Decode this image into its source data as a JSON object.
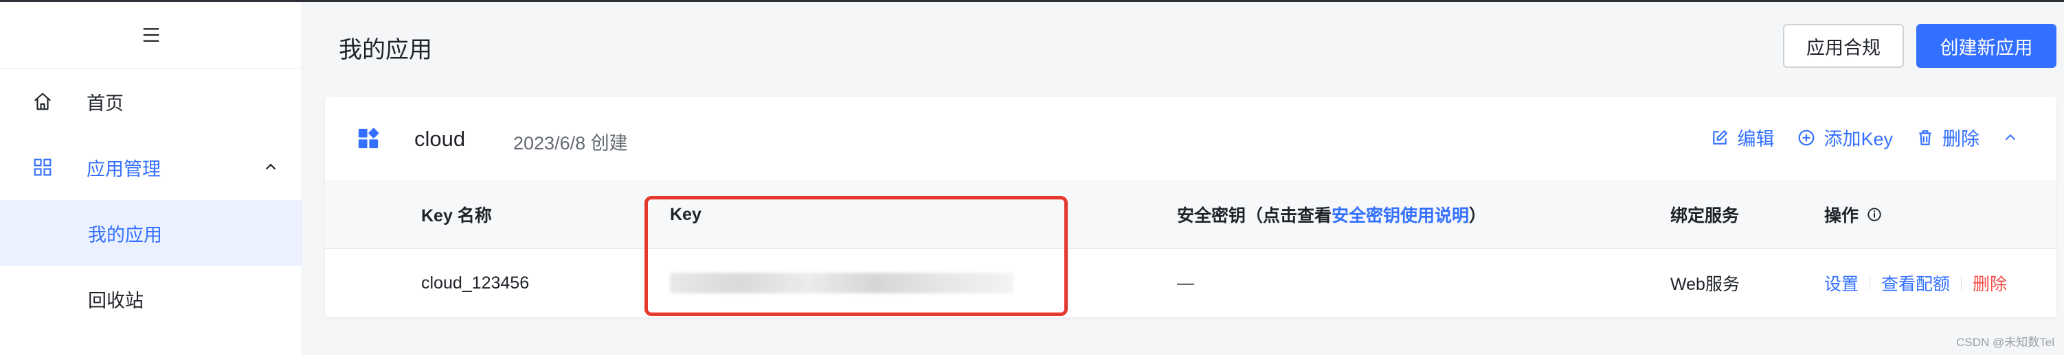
{
  "sidebar": {
    "items": [
      {
        "label": "首页"
      },
      {
        "label": "应用管理"
      }
    ],
    "subitems": [
      {
        "label": "我的应用"
      },
      {
        "label": "回收站"
      }
    ]
  },
  "main": {
    "title": "我的应用",
    "buttons": {
      "compliance": "应用合规",
      "create": "创建新应用"
    },
    "app": {
      "name": "cloud",
      "date": "2023/6/8 创建",
      "actions": {
        "edit": "编辑",
        "add_key": "添加Key",
        "delete": "删除"
      }
    },
    "table": {
      "headers": {
        "name": "Key 名称",
        "key": "Key",
        "secret_prefix": "安全密钥（点击查看",
        "secret_link": "安全密钥使用说明",
        "secret_suffix": "）",
        "service": "绑定服务",
        "ops": "操作"
      },
      "rows": [
        {
          "name": "cloud_123456",
          "secret": "—",
          "service": "Web服务",
          "ops": {
            "settings": "设置",
            "quota": "查看配额",
            "delete": "删除"
          }
        }
      ]
    }
  },
  "watermark": "CSDN @未知数Tel",
  "colors": {
    "accent": "#3370ff",
    "danger": "#f54a45",
    "highlight": "#e5382e"
  }
}
